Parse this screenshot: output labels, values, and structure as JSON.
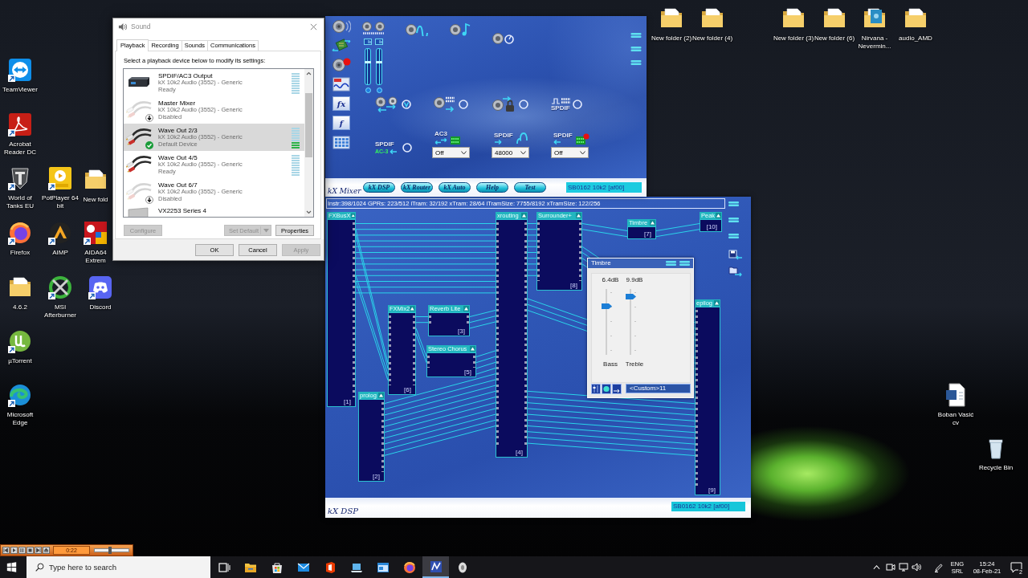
{
  "desktop": {
    "icons": [
      {
        "label": "New folder (2)",
        "kind": "folder",
        "shortcut": false
      },
      {
        "label": "New folder (4)",
        "kind": "folder",
        "shortcut": false
      },
      {
        "label": "New folder (3)",
        "kind": "folder",
        "shortcut": false
      },
      {
        "label": "New folder (6)",
        "kind": "folder",
        "shortcut": false
      },
      {
        "label": "Nirvana - Nevermin...",
        "kind": "album",
        "shortcut": false
      },
      {
        "label": "audio_AMD",
        "kind": "folder",
        "shortcut": false
      },
      {
        "label": "TeamViewer",
        "kind": "arrows",
        "shortcut": true
      },
      {
        "label": "Acrobat Reader DC",
        "kind": "pdf",
        "shortcut": true
      },
      {
        "label": "World of Tanks EU",
        "kind": "shield",
        "shortcut": true
      },
      {
        "label": "PotPlayer 64 bit",
        "kind": "player",
        "shortcut": true
      },
      {
        "label": "New fold",
        "kind": "folder",
        "shortcut": false
      },
      {
        "label": "Firefox",
        "kind": "globe",
        "shortcut": true
      },
      {
        "label": "AIMP",
        "kind": "triangle",
        "shortcut": true
      },
      {
        "label": "AIDA64 Extrem",
        "kind": "tile",
        "shortcut": true
      },
      {
        "label": "4.6.2",
        "kind": "folder",
        "shortcut": false
      },
      {
        "label": "MSI Afterburner",
        "kind": "ring",
        "shortcut": true
      },
      {
        "label": "Discord",
        "kind": "gamepad",
        "shortcut": true
      },
      {
        "label": "µTorrent",
        "kind": "ball",
        "shortcut": true
      },
      {
        "label": "Microsoft Edge",
        "kind": "wave",
        "shortcut": true
      },
      {
        "label": "Boban Vasić cv",
        "kind": "document",
        "shortcut": false
      },
      {
        "label": "Recycle Bin",
        "kind": "bin",
        "shortcut": false
      }
    ]
  },
  "sound_dialog": {
    "title": "Sound",
    "tabs": [
      {
        "label": "Playback",
        "selected": true
      },
      {
        "label": "Recording",
        "selected": false
      },
      {
        "label": "Sounds",
        "selected": false
      },
      {
        "label": "Communications",
        "selected": false
      }
    ],
    "instruction": "Select a playback device below to modify its settings:",
    "devices": [
      {
        "name": "SPDIF/AC3 Output",
        "driver": "kX 10k2 Audio (3552) - Generic",
        "status": "Ready",
        "kind": "receiver",
        "disabled": false,
        "default": false,
        "selected": false,
        "level": 0
      },
      {
        "name": "Master Mixer",
        "driver": "kX 10k2 Audio (3552) - Generic",
        "status": "Disabled",
        "kind": "cable",
        "disabled": true,
        "default": false,
        "selected": false
      },
      {
        "name": "Wave Out 2/3",
        "driver": "kX 10k2 Audio (3552) - Generic",
        "status": "Default Device",
        "kind": "cable",
        "disabled": false,
        "default": true,
        "selected": true,
        "level": 0.3
      },
      {
        "name": "Wave Out 4/5",
        "driver": "kX 10k2 Audio (3552) - Generic",
        "status": "Ready",
        "kind": "cable",
        "disabled": false,
        "default": false,
        "selected": false,
        "level": 0
      },
      {
        "name": "Wave Out 6/7",
        "driver": "kX 10k2 Audio (3552) - Generic",
        "status": "Disabled",
        "kind": "cable",
        "disabled": true,
        "default": false,
        "selected": false
      },
      {
        "name": "VX2253 Series 4",
        "kind": "monitor",
        "disabled": false,
        "default": false,
        "selected": false
      }
    ],
    "buttons": [
      {
        "label": "Configure",
        "disabled": true,
        "kind": "plain"
      },
      {
        "label": "Set Default",
        "disabled": true,
        "kind": "split"
      },
      {
        "label": "Properties",
        "disabled": false,
        "kind": "plain"
      }
    ],
    "footer_buttons": [
      {
        "label": "OK",
        "disabled": false
      },
      {
        "label": "Cancel",
        "disabled": false
      },
      {
        "label": "Apply",
        "disabled": true
      }
    ]
  },
  "mixer": {
    "tool_buttons": [
      {
        "kind": "speaker"
      },
      {
        "kind": "board"
      },
      {
        "kind": "record"
      },
      {
        "kind": "graph"
      },
      {
        "kind": "letter",
        "text": "fx"
      },
      {
        "kind": "letter",
        "text": "f"
      },
      {
        "kind": "grid"
      }
    ],
    "sliders": [
      {
        "level": 0.63
      },
      {
        "level": 0.63
      }
    ],
    "routes": [
      {
        "kind": "swap"
      },
      {
        "kind": "digital"
      },
      {
        "kind": "lock"
      },
      {
        "kind": "pulse",
        "label": "SPDIF"
      }
    ],
    "spdif_in": {
      "label": "SPDIF",
      "format": "AC-3"
    },
    "selects": [
      {
        "label": "AC3",
        "kind": "exchange",
        "value": "Off"
      },
      {
        "label": "SPDIF",
        "kind": "wave",
        "value": "48000"
      },
      {
        "label": "SPDIF",
        "kind": "record",
        "value": "Off"
      }
    ],
    "nav_buttons": [
      "kX DSP",
      "kX Router",
      "kX Auto",
      "Help",
      "Test"
    ],
    "logo": "kX Mixer",
    "device": "SB0162 10k2 [af00]"
  },
  "dsp": {
    "stats": "Instr:398/1024 GPRs: 223/512 iTram: 32/192 xTram: 28/64 iTramSize: 7755/8192 xTramSize: 122/256",
    "nodes": [
      {
        "title": "FXBusX",
        "number": "[1]"
      },
      {
        "title": "xrouting",
        "number": "[4]"
      },
      {
        "title": "Surrounder+",
        "number": "[8]"
      },
      {
        "title": "Timbre",
        "number": "[7]"
      },
      {
        "title": "Peak",
        "number": "[10]"
      },
      {
        "title": "epilog",
        "number": "[9]"
      },
      {
        "title": "FXMix2",
        "number": "[6]"
      },
      {
        "title": "Reverb Lite",
        "number": "[3]"
      },
      {
        "title": "Stereo Chorus",
        "number": "[5]"
      },
      {
        "title": "prolog",
        "number": "[2]"
      }
    ],
    "timbre_window": {
      "title": "Timbre",
      "controls": [
        {
          "reading": "6.4dB",
          "label": "Bass",
          "level": 0.74
        },
        {
          "reading": "9.9dB",
          "label": "Treble",
          "level": 0.88
        }
      ],
      "preset": "<Custom>11"
    },
    "logo": "kX DSP",
    "device": "SB0162 10k2 [af00]"
  },
  "mini_player": {
    "time": "0:22",
    "volume": {
      "level": 0.45
    }
  },
  "taskbar": {
    "search": {
      "placeholder": "Type here to search"
    },
    "apps": [
      {
        "kind": "taskview",
        "selected": false
      },
      {
        "kind": "folder",
        "selected": false
      },
      {
        "kind": "store",
        "selected": false
      },
      {
        "kind": "mail",
        "selected": false
      },
      {
        "kind": "office",
        "selected": false
      },
      {
        "kind": "laptop",
        "selected": false
      },
      {
        "kind": "window",
        "selected": false
      },
      {
        "kind": "globe",
        "selected": false
      },
      {
        "kind": "mixer",
        "selected": true
      },
      {
        "kind": "oval",
        "selected": false
      }
    ],
    "tray": {
      "language": "ENG",
      "layout": "SRL",
      "time": "15:24",
      "date": "08-Feb-21",
      "notifications": "2"
    }
  }
}
